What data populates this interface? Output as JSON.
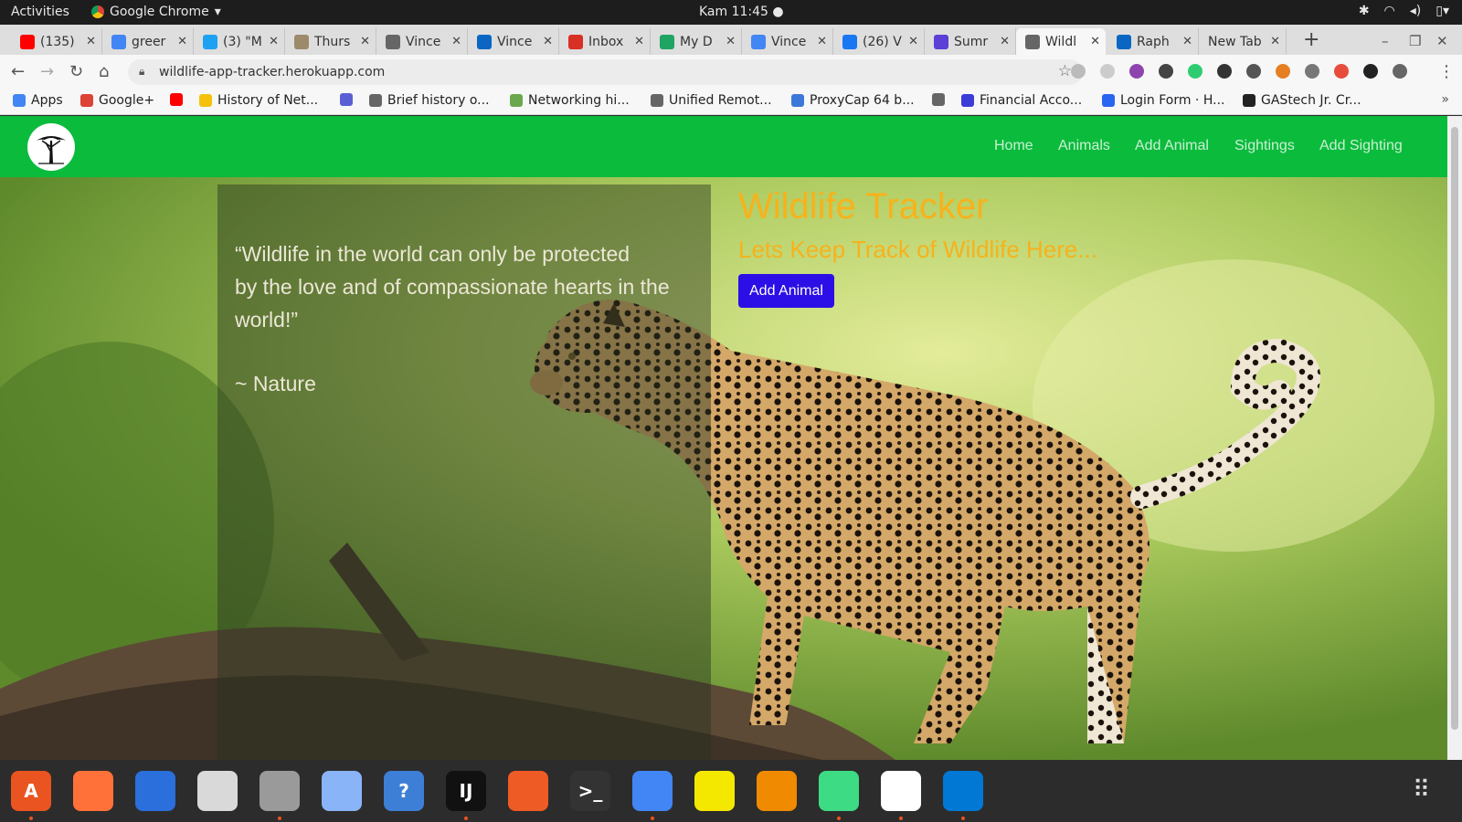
{
  "system": {
    "activities": "Activities",
    "app_name": "Google Chrome",
    "clock": "Kam 11:45 ●"
  },
  "tabs": [
    {
      "title": "(135)",
      "icon": "youtube-icon",
      "color": "#ff0000"
    },
    {
      "title": "greer",
      "icon": "google-icon",
      "color": "#4285f4"
    },
    {
      "title": "(3) \"M",
      "icon": "twitter-icon",
      "color": "#1da1f2"
    },
    {
      "title": "Thurs",
      "icon": "palm-tree-icon",
      "color": "#9c8a6b"
    },
    {
      "title": "Vince",
      "icon": "globe-icon",
      "color": "#666666"
    },
    {
      "title": "Vince",
      "icon": "linkedin-icon",
      "color": "#0a66c2"
    },
    {
      "title": "Inbox",
      "icon": "gmail-icon",
      "color": "#d93025"
    },
    {
      "title": "My D",
      "icon": "drive-icon",
      "color": "#1fa463"
    },
    {
      "title": "Vince",
      "icon": "docs-icon",
      "color": "#4285f4"
    },
    {
      "title": "(26) V",
      "icon": "facebook-icon",
      "color": "#1877f2"
    },
    {
      "title": "Sumr",
      "icon": "p-icon",
      "color": "#5b3fd6"
    },
    {
      "title": "Wildl",
      "icon": "globe-icon",
      "color": "#666666",
      "active": true
    },
    {
      "title": "Raph",
      "icon": "linkedin-icon",
      "color": "#0a66c2"
    },
    {
      "title": "New Tab",
      "icon": "",
      "color": ""
    }
  ],
  "toolbar": {
    "url": "wildlife-app-tracker.herokuapp.com"
  },
  "bookmarks": [
    {
      "label": "Apps",
      "icon": "apps-grid-icon",
      "color": "#4285f4"
    },
    {
      "label": "Google+",
      "icon": "google-plus-icon",
      "color": "#db4437"
    },
    {
      "label": "",
      "icon": "youtube-icon",
      "color": "#ff0000"
    },
    {
      "label": "History of Net...",
      "icon": "bookmark-l-icon",
      "color": "#f4c20d"
    },
    {
      "label": "",
      "icon": "docs-icon",
      "color": "#5b5fd6"
    },
    {
      "label": "Brief history o...",
      "icon": "globe-icon",
      "color": "#666666"
    },
    {
      "label": "Networking hi...",
      "icon": "network-icon",
      "color": "#6aa84f"
    },
    {
      "label": "Unified Remot...",
      "icon": "globe-icon",
      "color": "#666666"
    },
    {
      "label": "ProxyCap 64 b...",
      "icon": "proxycap-icon",
      "color": "#3c78d8"
    },
    {
      "label": "",
      "icon": "globe-icon",
      "color": "#666666"
    },
    {
      "label": "Financial Acco...",
      "icon": "arrow-a-icon",
      "color": "#3c3cd6"
    },
    {
      "label": "Login Form · H...",
      "icon": "css-icon",
      "color": "#2965f1"
    },
    {
      "label": "GAStech Jr. Cr...",
      "icon": "wikipedia-icon",
      "color": "#222222"
    }
  ],
  "site": {
    "nav": [
      "Home",
      "Animals",
      "Add Animal",
      "Sightings",
      "Add Sighting"
    ],
    "quote_line1": "“Wildlife in the world can only be protected",
    "quote_line2": "by the love and of compassionate hearts in the",
    "quote_line3": "world!”",
    "quote_author": "~ Nature",
    "title": "Wildlife Tracker",
    "subtitle": "Lets Keep Track of Wildlife Here...",
    "cta": "Add Animal"
  },
  "colors": {
    "nav_bg": "#0bbb3c",
    "accent": "#f7b21b",
    "button": "#2c0fe6"
  },
  "dock": [
    {
      "name": "software-center-icon",
      "color": "#e95420",
      "glyph": "A",
      "running": true
    },
    {
      "name": "firefox-icon",
      "color": "#ff7139",
      "glyph": "",
      "running": false
    },
    {
      "name": "thunderbird-icon",
      "color": "#2a6fdb",
      "glyph": "",
      "running": false
    },
    {
      "name": "rhythmbox-icon",
      "color": "#d9d9d9",
      "glyph": "",
      "running": false
    },
    {
      "name": "files-icon",
      "color": "#9a9a9a",
      "glyph": "",
      "running": true
    },
    {
      "name": "image-viewer-icon",
      "color": "#8ab4f8",
      "glyph": "",
      "running": false
    },
    {
      "name": "help-icon",
      "color": "#3d7fd6",
      "glyph": "?",
      "running": false
    },
    {
      "name": "intellij-icon",
      "color": "#111111",
      "glyph": "IJ",
      "running": true
    },
    {
      "name": "postman-icon",
      "color": "#ef5b25",
      "glyph": "",
      "running": false
    },
    {
      "name": "terminal-icon",
      "color": "#333333",
      "glyph": ">_",
      "running": false
    },
    {
      "name": "chrome-icon",
      "color": "#4285f4",
      "glyph": "",
      "running": true
    },
    {
      "name": "notes-icon",
      "color": "#f4e800",
      "glyph": "",
      "running": false
    },
    {
      "name": "vlc-icon",
      "color": "#f08a00",
      "glyph": "",
      "running": false
    },
    {
      "name": "android-studio-icon",
      "color": "#3ddc84",
      "glyph": "",
      "running": true
    },
    {
      "name": "slack-icon",
      "color": "#ffffff",
      "glyph": "",
      "running": true
    },
    {
      "name": "vscode-icon",
      "color": "#0078d4",
      "glyph": "",
      "running": true
    }
  ]
}
